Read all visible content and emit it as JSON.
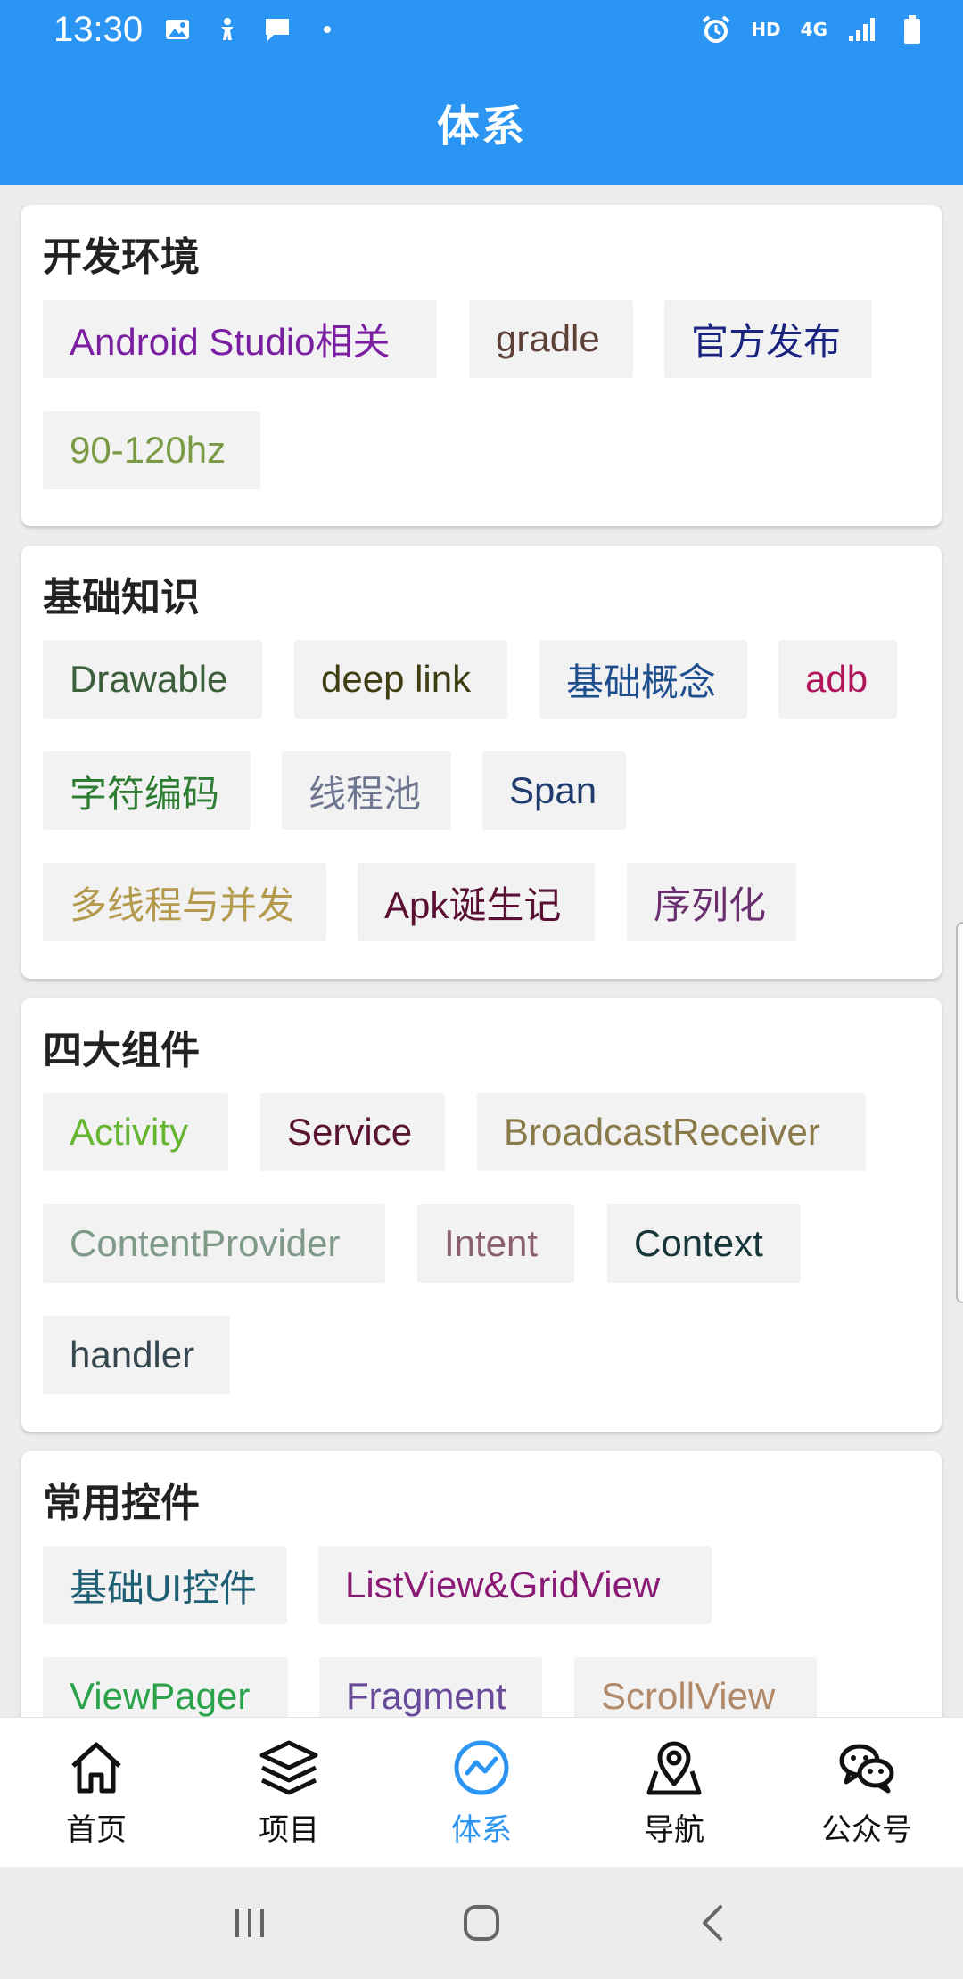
{
  "status_bar": {
    "time": "13:30",
    "hd_label": "HD",
    "network_label": "4G",
    "icons_left": [
      "image-icon",
      "accessibility-icon",
      "message-icon",
      "dot-icon"
    ],
    "icons_right": [
      "alarm-icon",
      "signal-icon",
      "battery-icon"
    ]
  },
  "header": {
    "title": "体系"
  },
  "sections": [
    {
      "title": "开发环境",
      "tags": [
        {
          "label": "Android Studio相关",
          "color": "#7b1fa2"
        },
        {
          "label": "gradle",
          "color": "#5d4037"
        },
        {
          "label": "官方发布",
          "color": "#1a237e"
        },
        {
          "label": "90-120hz",
          "color": "#7a9a45"
        }
      ]
    },
    {
      "title": "基础知识",
      "tags": [
        {
          "label": "Drawable",
          "color": "#3b5e3b"
        },
        {
          "label": "deep link",
          "color": "#3e3e12"
        },
        {
          "label": "基础概念",
          "color": "#1f4e8c"
        },
        {
          "label": "adb",
          "color": "#b0155b"
        },
        {
          "label": "字符编码",
          "color": "#2e7d32"
        },
        {
          "label": "线程池",
          "color": "#6f7690"
        },
        {
          "label": "Span",
          "color": "#1f3b6e"
        },
        {
          "label": "多线程与并发",
          "color": "#b39a4c"
        },
        {
          "label": "Apk诞生记",
          "color": "#5b1033"
        },
        {
          "label": "序列化",
          "color": "#6a2f6e"
        }
      ]
    },
    {
      "title": "四大组件",
      "tags": [
        {
          "label": "Activity",
          "color": "#66b530"
        },
        {
          "label": "Service",
          "color": "#5a1330"
        },
        {
          "label": "BroadcastReceiver",
          "color": "#8a7a4a"
        },
        {
          "label": "ContentProvider",
          "color": "#7f9a88"
        },
        {
          "label": "Intent",
          "color": "#8a5f6e"
        },
        {
          "label": "Context",
          "color": "#16363a"
        },
        {
          "label": "handler",
          "color": "#37474f"
        }
      ]
    },
    {
      "title": "常用控件",
      "tags": [
        {
          "label": "基础UI控件",
          "color": "#1e5f74"
        },
        {
          "label": "ListView&GridView",
          "color": "#8a1a75"
        },
        {
          "label": "ViewPager",
          "color": "#2aa34a"
        },
        {
          "label": "Fragment",
          "color": "#6a4a9a"
        },
        {
          "label": "ScrollView",
          "color": "#b08a6a"
        }
      ]
    }
  ],
  "bottom_nav": [
    {
      "label": "首页",
      "icon": "home-icon",
      "active": false
    },
    {
      "label": "项目",
      "icon": "layers-icon",
      "active": false
    },
    {
      "label": "体系",
      "icon": "trend-icon",
      "active": true
    },
    {
      "label": "导航",
      "icon": "map-pin-icon",
      "active": false
    },
    {
      "label": "公众号",
      "icon": "wechat-icon",
      "active": false
    }
  ],
  "colors": {
    "primary": "#2a95f2",
    "chip_background": "#f2f2f3",
    "page_background": "#ececec"
  }
}
